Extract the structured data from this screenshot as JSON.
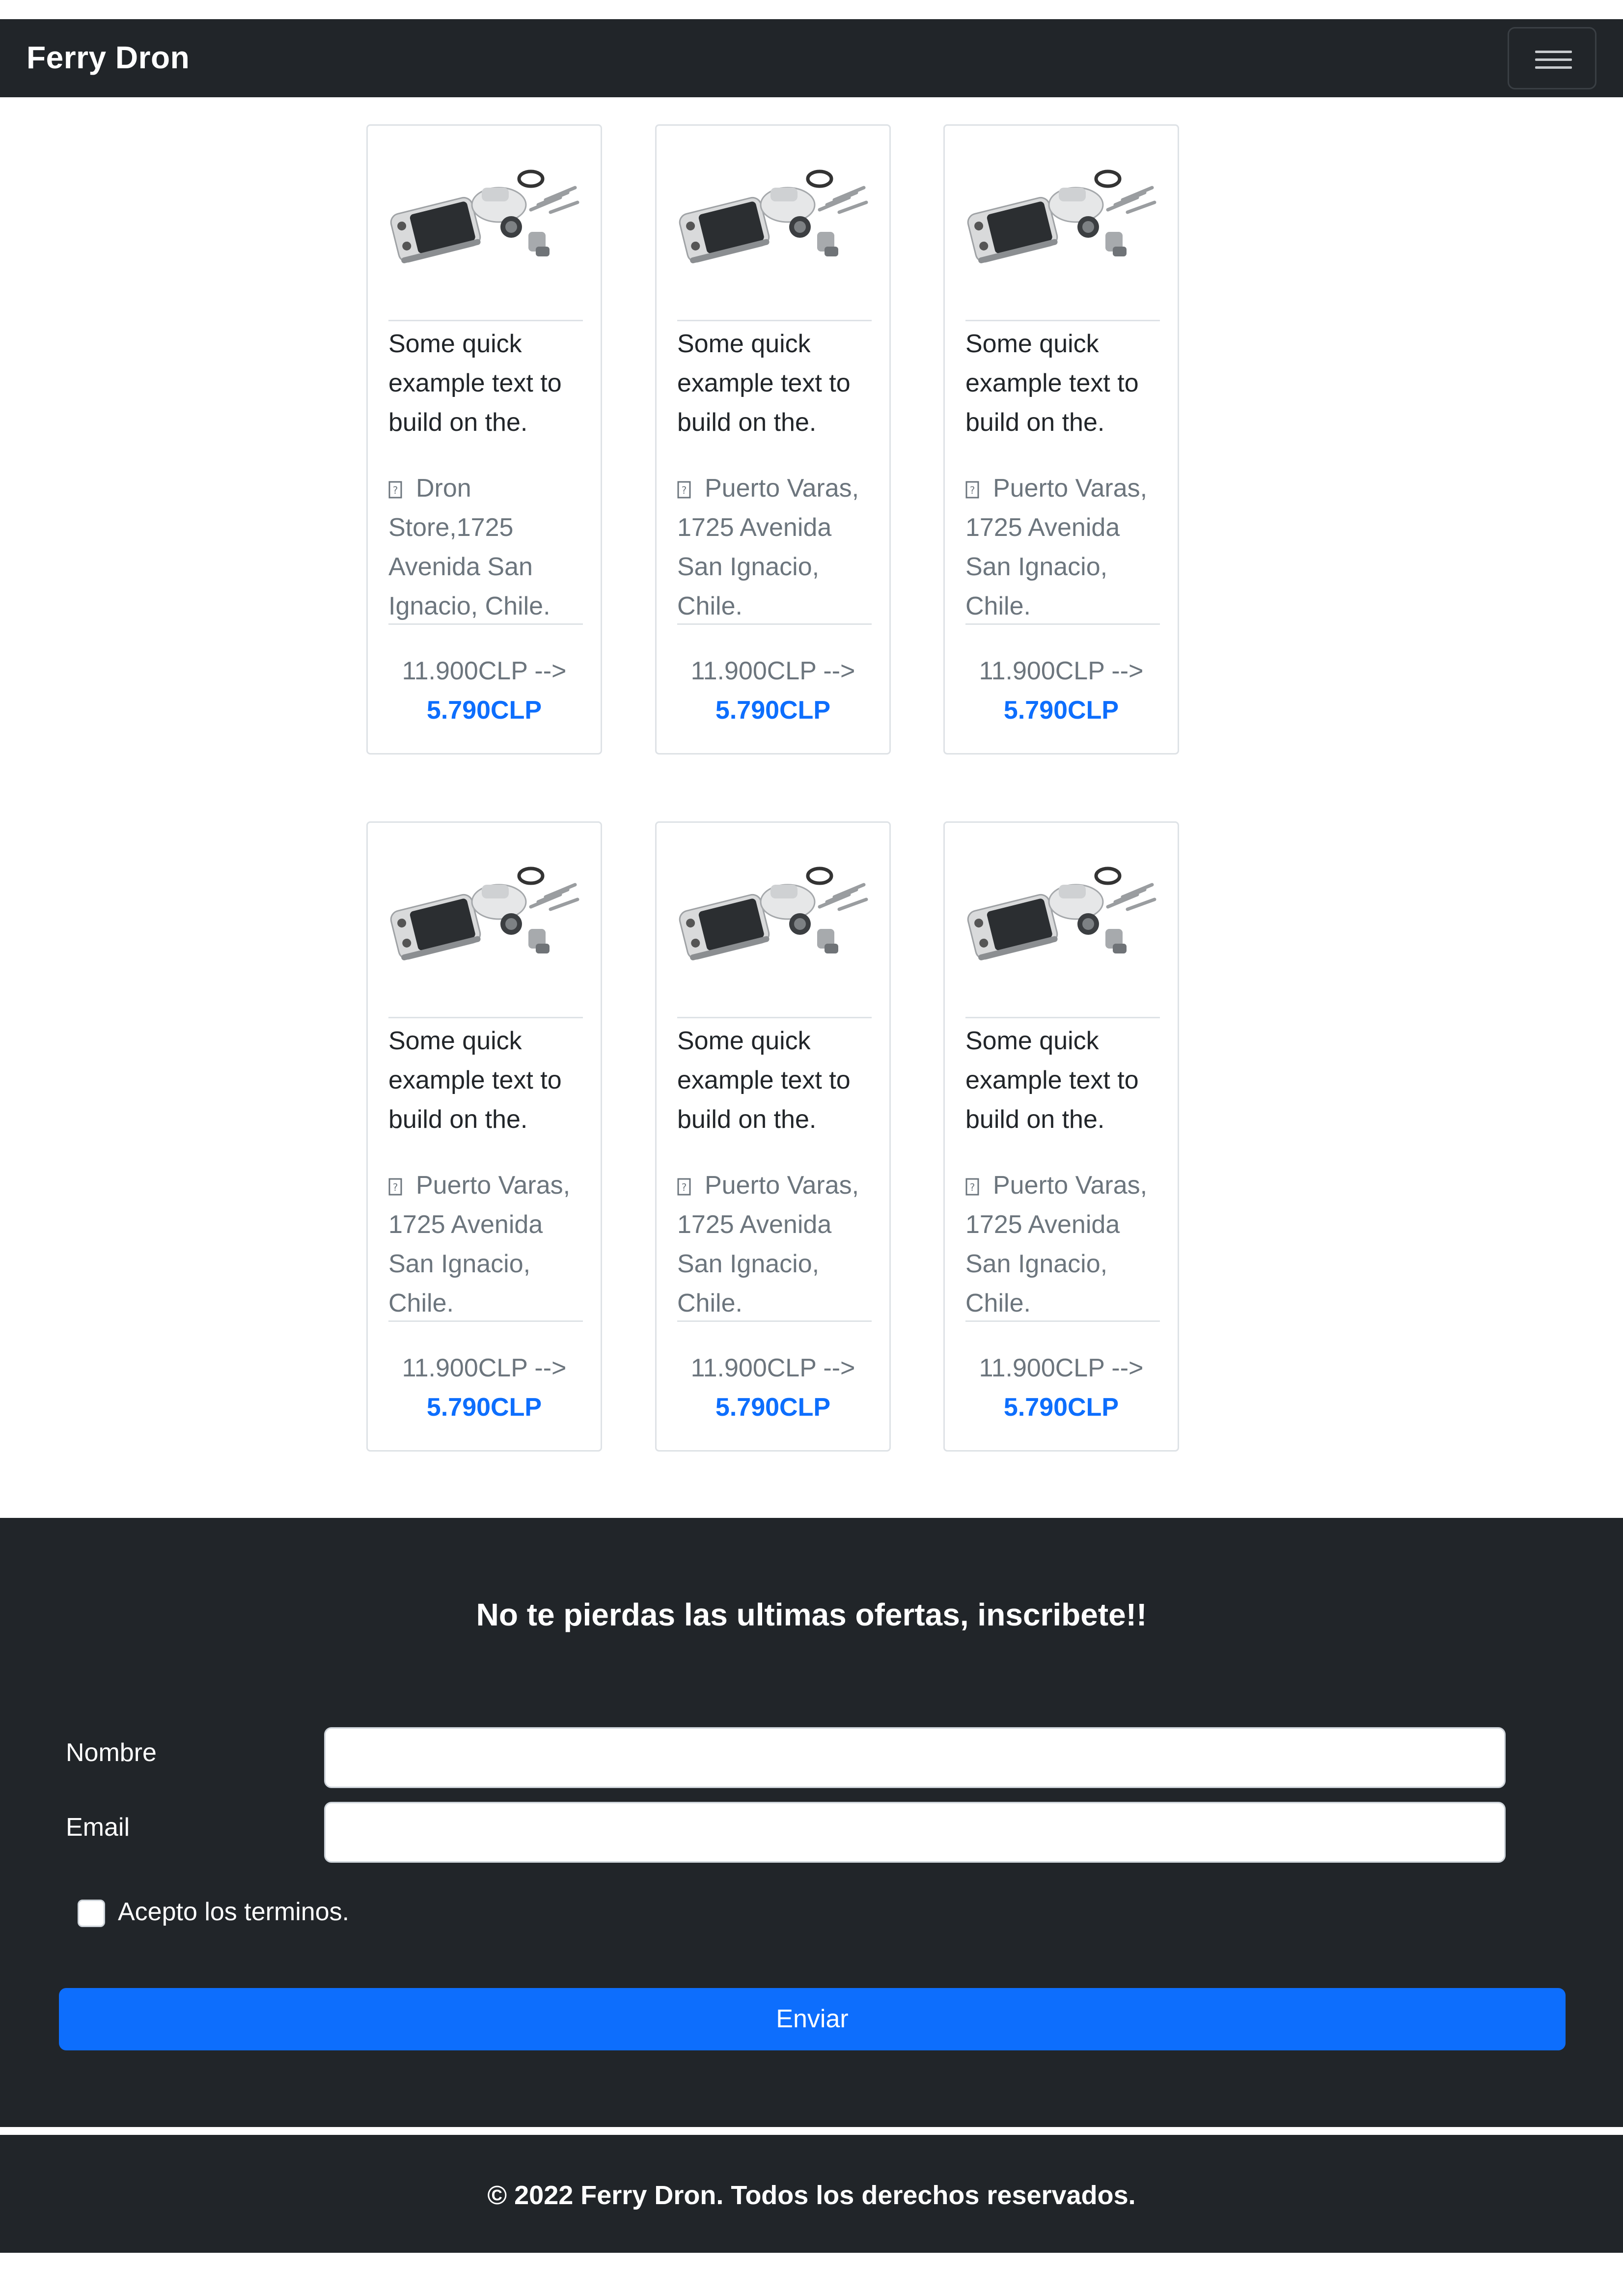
{
  "navbar": {
    "brand": "Ferry Dron",
    "toggler_icon": "hamburger-menu-icon"
  },
  "products": [
    {
      "text": "Some quick example text to build on the.",
      "location_icon": "location-pin-icon",
      "location": "Dron Store,1725 Avenida San Ignacio, Chile.",
      "old_price": "11.900CLP -->",
      "new_price": "5.790CLP"
    },
    {
      "text": "Some quick example text to build on the.",
      "location_icon": "location-pin-icon",
      "location": "Puerto Varas, 1725 Avenida San Ignacio, Chile.",
      "old_price": "11.900CLP -->",
      "new_price": "5.790CLP"
    },
    {
      "text": "Some quick example text to build on the.",
      "location_icon": "location-pin-icon",
      "location": "Puerto Varas, 1725 Avenida San Ignacio, Chile.",
      "old_price": "11.900CLP -->",
      "new_price": "5.790CLP"
    },
    {
      "text": "Some quick example text to build on the.",
      "location_icon": "location-pin-icon",
      "location": "Puerto Varas, 1725 Avenida San Ignacio, Chile.",
      "old_price": "11.900CLP -->",
      "new_price": "5.790CLP"
    },
    {
      "text": "Some quick example text to build on the.",
      "location_icon": "location-pin-icon",
      "location": "Puerto Varas, 1725 Avenida San Ignacio, Chile.",
      "old_price": "11.900CLP -->",
      "new_price": "5.790CLP"
    },
    {
      "text": "Some quick example text to build on the.",
      "location_icon": "location-pin-icon",
      "location": "Puerto Varas, 1725 Avenida San Ignacio, Chile.",
      "old_price": "11.900CLP -->",
      "new_price": "5.790CLP"
    }
  ],
  "newsletter": {
    "title": "No te pierdas las ultimas ofertas, inscribete!!",
    "name_label": "Nombre",
    "name_value": "",
    "email_label": "Email",
    "email_value": "",
    "terms_label": "Acepto los terminos.",
    "terms_checked": false,
    "submit_label": "Enviar"
  },
  "footer": {
    "copyright": "© 2022 Ferry Dron. Todos los derechos reservados."
  },
  "colors": {
    "dark": "#212529",
    "primary": "#0d6efd",
    "muted": "#6c757d",
    "border": "#dee2e6"
  }
}
